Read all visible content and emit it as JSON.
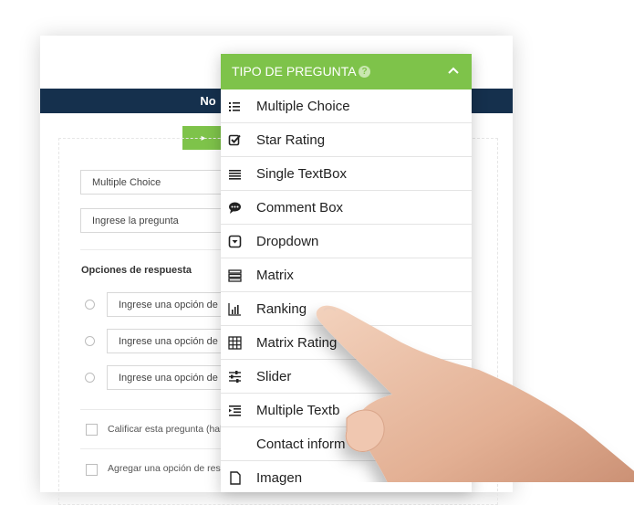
{
  "editor": {
    "banner_text": "No",
    "question_type_value": "Multiple Choice",
    "question_placeholder": "Ingrese la pregunta",
    "answers_title": "Opciones de respuesta",
    "answer_placeholders": [
      "Ingrese una opción de re",
      "Ingrese una opción de re",
      "Ingrese una opción de re"
    ],
    "checkbox_options": [
      "Calificar esta pregunta (hab",
      "Agregar una opción de resp"
    ]
  },
  "dropdown": {
    "header": "TIPO DE PREGUNTA",
    "items": [
      {
        "label": "Multiple Choice",
        "icon": "list-icon"
      },
      {
        "label": "Star Rating",
        "icon": "checkbox-icon"
      },
      {
        "label": "Single TextBox",
        "icon": "lines-icon"
      },
      {
        "label": "Comment Box",
        "icon": "comment-icon"
      },
      {
        "label": "Dropdown",
        "icon": "dropdown-icon"
      },
      {
        "label": "Matrix",
        "icon": "matrix-icon"
      },
      {
        "label": "Ranking",
        "icon": "bar-chart-icon"
      },
      {
        "label": "Matrix Rating",
        "icon": "grid-icon"
      },
      {
        "label": "Slider",
        "icon": "sliders-icon"
      },
      {
        "label": "Multiple Textb",
        "icon": "indent-icon"
      },
      {
        "label": "Contact inform",
        "icon": ""
      },
      {
        "label": "Imagen",
        "icon": "image-icon"
      }
    ]
  },
  "colors": {
    "accent": "#7ec34a",
    "banner": "#15304d"
  }
}
